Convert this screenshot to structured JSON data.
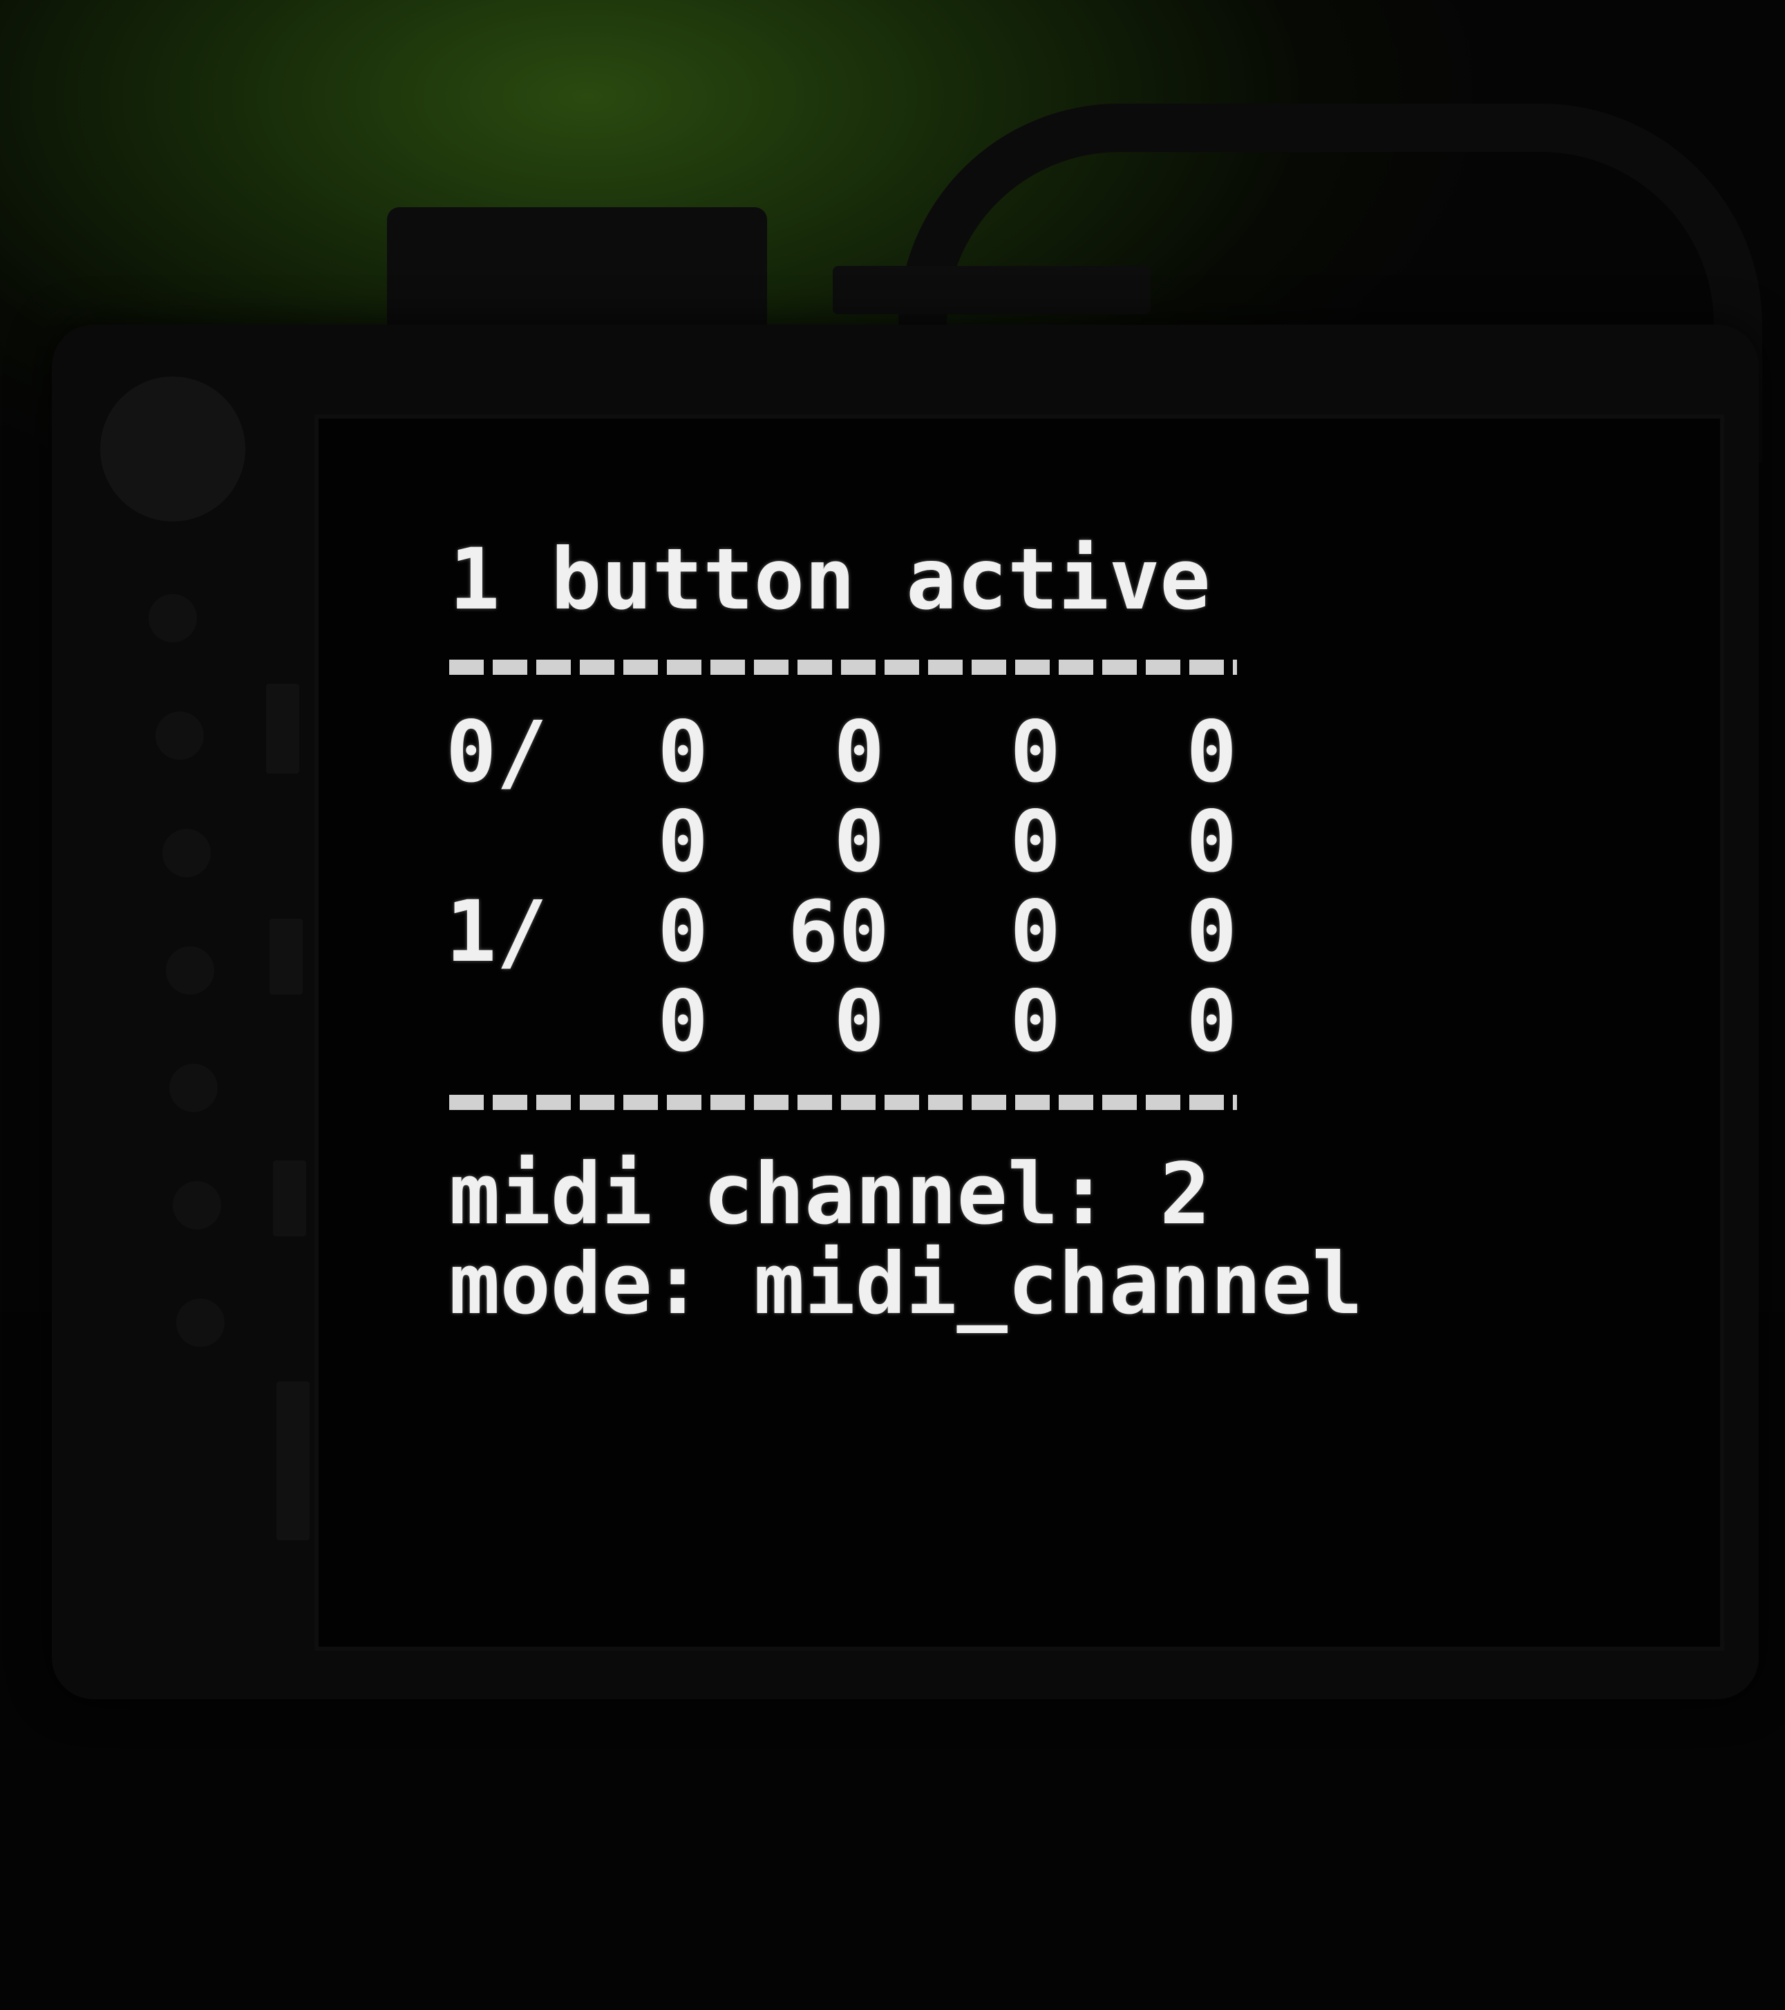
{
  "display": {
    "status_line": "1 button active",
    "rows": [
      {
        "label": "0/",
        "values": [
          "0",
          "0",
          "0",
          "0"
        ]
      },
      {
        "label": "",
        "values": [
          "0",
          "0",
          "0",
          "0"
        ]
      },
      {
        "label": "1/",
        "values": [
          "0",
          "60",
          "0",
          "0"
        ]
      },
      {
        "label": "",
        "values": [
          "0",
          "0",
          "0",
          "0"
        ]
      }
    ],
    "midi_channel_line": "midi channel: 2",
    "mode_line": "mode: midi_channel"
  },
  "colors": {
    "text": "#f0f0f0",
    "background_glow": "#2a4a10",
    "screen": "#020202"
  }
}
